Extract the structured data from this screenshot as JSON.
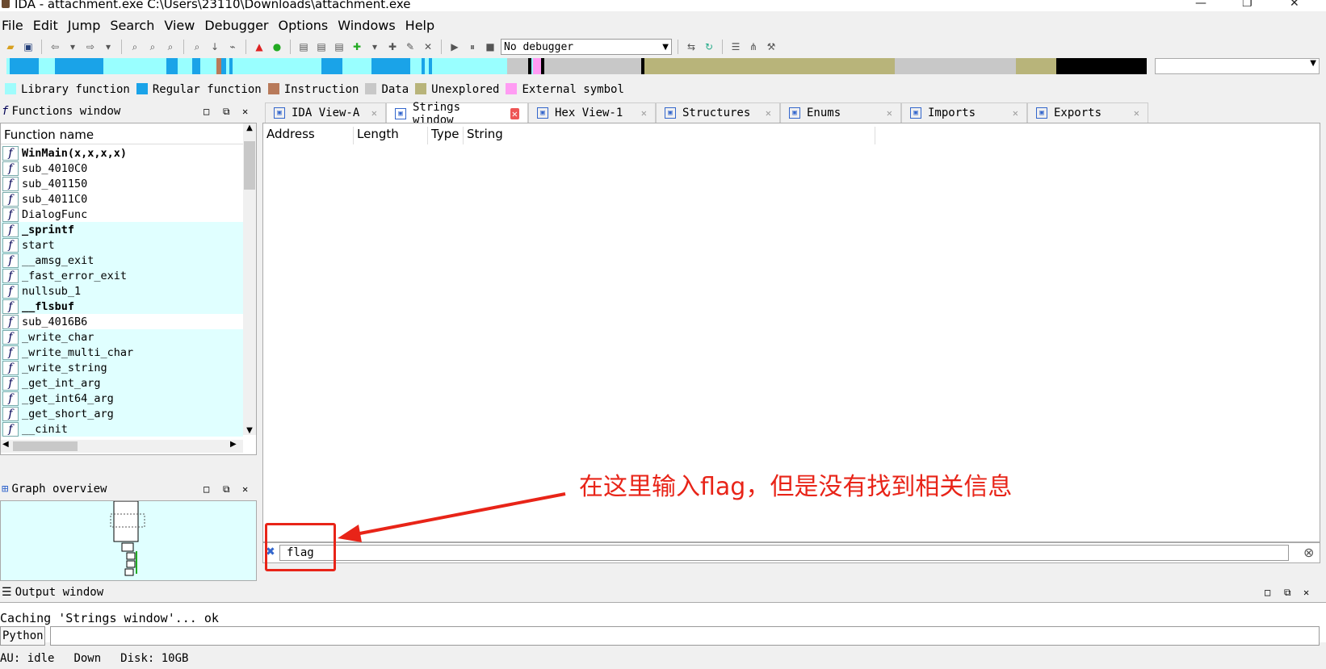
{
  "window": {
    "title": "IDA - attachment.exe C:\\Users\\23110\\Downloads\\attachment.exe"
  },
  "menu": [
    "File",
    "Edit",
    "Jump",
    "Search",
    "View",
    "Debugger",
    "Options",
    "Windows",
    "Help"
  ],
  "toolbar": {
    "debugger_select": "No debugger"
  },
  "legend": [
    {
      "label": "Library function",
      "color": "#9ffcfc"
    },
    {
      "label": "Regular function",
      "color": "#1aa3e8"
    },
    {
      "label": "Instruction",
      "color": "#b87a5a"
    },
    {
      "label": "Data",
      "color": "#c8c8c8"
    },
    {
      "label": "Unexplored",
      "color": "#b8b47a"
    },
    {
      "label": "External symbol",
      "color": "#ff9cf3"
    }
  ],
  "functions_window": {
    "title": "Functions window",
    "column": "Function name",
    "rows": [
      {
        "name": "WinMain(x,x,x,x)",
        "lib": false,
        "bold": true
      },
      {
        "name": "sub_4010C0",
        "lib": false,
        "bold": false
      },
      {
        "name": "sub_401150",
        "lib": false,
        "bold": false
      },
      {
        "name": "sub_4011C0",
        "lib": false,
        "bold": false
      },
      {
        "name": "DialogFunc",
        "lib": false,
        "bold": false
      },
      {
        "name": "_sprintf",
        "lib": true,
        "bold": true
      },
      {
        "name": "start",
        "lib": true,
        "bold": false
      },
      {
        "name": "__amsg_exit",
        "lib": true,
        "bold": false
      },
      {
        "name": "_fast_error_exit",
        "lib": true,
        "bold": false
      },
      {
        "name": "nullsub_1",
        "lib": true,
        "bold": false
      },
      {
        "name": "__flsbuf",
        "lib": true,
        "bold": true
      },
      {
        "name": "sub_4016B6",
        "lib": false,
        "bold": false
      },
      {
        "name": "_write_char",
        "lib": true,
        "bold": false
      },
      {
        "name": "_write_multi_char",
        "lib": true,
        "bold": false
      },
      {
        "name": "_write_string",
        "lib": true,
        "bold": false
      },
      {
        "name": "_get_int_arg",
        "lib": true,
        "bold": false
      },
      {
        "name": "_get_int64_arg",
        "lib": true,
        "bold": false
      },
      {
        "name": "_get_short_arg",
        "lib": true,
        "bold": false
      },
      {
        "name": "__cinit",
        "lib": true,
        "bold": false
      }
    ]
  },
  "graph_overview": {
    "title": "Graph overview"
  },
  "tabs": [
    {
      "label": "IDA View-A",
      "active": false
    },
    {
      "label": "Strings window",
      "active": true
    },
    {
      "label": "Hex View-1",
      "active": false
    },
    {
      "label": "Structures",
      "active": false
    },
    {
      "label": "Enums",
      "active": false
    },
    {
      "label": "Imports",
      "active": false
    },
    {
      "label": "Exports",
      "active": false
    }
  ],
  "strings_window": {
    "columns": [
      "Address",
      "Length",
      "Type",
      "String"
    ]
  },
  "search": {
    "value": "flag"
  },
  "annotation": "在这里输入flag，但是没有找到相关信息",
  "output_window": {
    "title": "Output window",
    "line": "Caching 'Strings window'... ok"
  },
  "cmd": {
    "lang": "Python"
  },
  "status": {
    "state": "AU:  idle",
    "direction": "Down",
    "disk": "Disk: 10GB"
  }
}
